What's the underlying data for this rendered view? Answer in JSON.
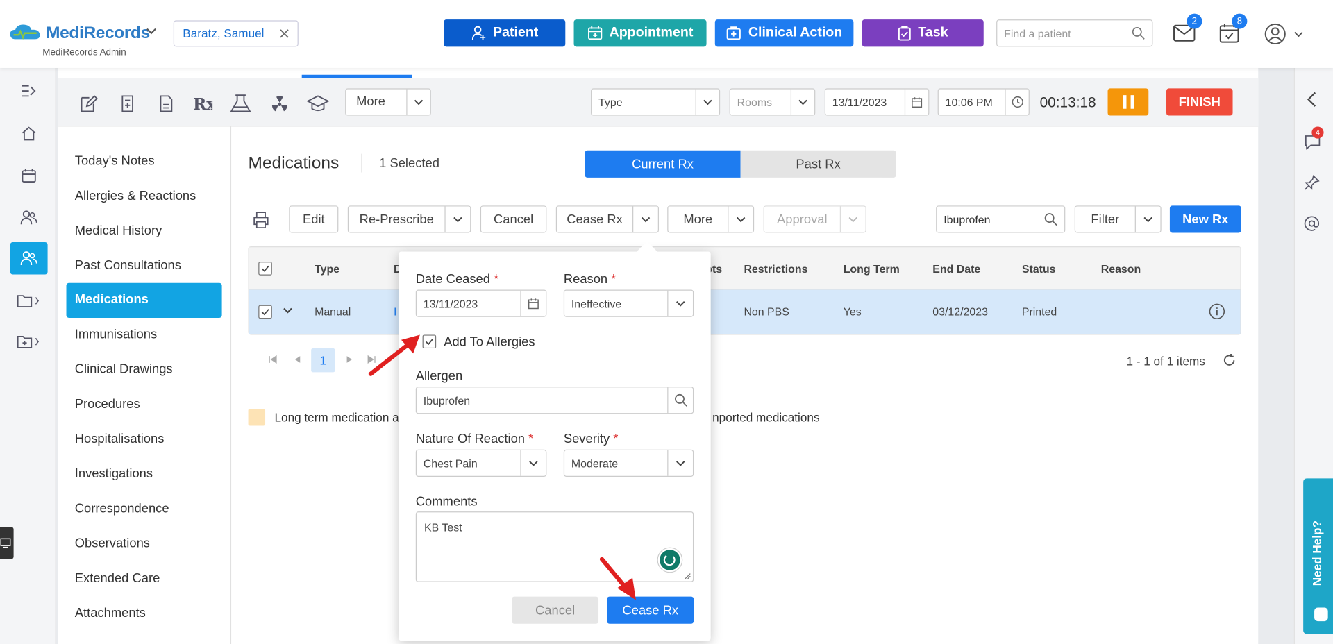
{
  "header": {
    "logo": "MediRecords",
    "logo_sub": "MediRecords Admin",
    "patient": "Baratz, Samuel",
    "buttons": [
      "Patient",
      "Appointment",
      "Clinical Action",
      "Task"
    ],
    "find_placeholder": "Find a patient",
    "mail_count": "2",
    "calendar_count": "8",
    "chat_count": "4"
  },
  "toolbar": {
    "more": "More",
    "type": "Type",
    "rooms": "Rooms",
    "date": "13/11/2023",
    "time": "10:06 PM",
    "timer": "00:13:18",
    "finish": "FINISH"
  },
  "sidebar": {
    "items": [
      "Today's Notes",
      "Allergies & Reactions",
      "Medical History",
      "Past Consultations",
      "Medications",
      "Immunisations",
      "Clinical Drawings",
      "Procedures",
      "Hospitalisations",
      "Investigations",
      "Correspondence",
      "Observations",
      "Extended Care",
      "Attachments"
    ],
    "active": "Medications"
  },
  "main": {
    "title": "Medications",
    "selected": "1 Selected",
    "tabs": [
      "Current Rx",
      "Past Rx"
    ],
    "actions": [
      "Edit",
      "Re-Prescribe",
      "Cancel",
      "Cease Rx",
      "More",
      "Approval",
      "Filter",
      "New Rx"
    ],
    "search_value": "Ibuprofen",
    "columns": [
      "Type",
      "D",
      "ots",
      "Restrictions",
      "Long Term",
      "End Date",
      "Status",
      "Reason"
    ],
    "row": {
      "type": "Manual",
      "d": "I",
      "restrictions": "Non PBS",
      "long_term": "Yes",
      "end_date": "03/12/2023",
      "status": "Printed"
    },
    "page": "1",
    "items_info": "1 - 1 of 1 items",
    "legend_left": "Long term medication a",
    "legend_right": "nported medications"
  },
  "popup": {
    "date_label": "Date Ceased",
    "date_value": "13/11/2023",
    "reason_label": "Reason",
    "reason_value": "Ineffective",
    "add_allergies": "Add To Allergies",
    "allergen_label": "Allergen",
    "allergen_value": "Ibuprofen",
    "nature_label": "Nature Of Reaction",
    "nature_value": "Chest Pain",
    "severity_label": "Severity",
    "severity_value": "Moderate",
    "comments_label": "Comments",
    "comments_value": "KB Test",
    "cancel": "Cancel",
    "submit": "Cease Rx",
    "required_mark": "*"
  },
  "help": {
    "label": "Need Help?"
  },
  "colors": {
    "patient": "#0a5ccc",
    "appointment": "#1ea6a8",
    "clinical": "#1e7cf0",
    "task": "#7b3fbf",
    "accent": "#12a4e3",
    "finish": "#f04b3a",
    "pause": "#f5960a"
  }
}
